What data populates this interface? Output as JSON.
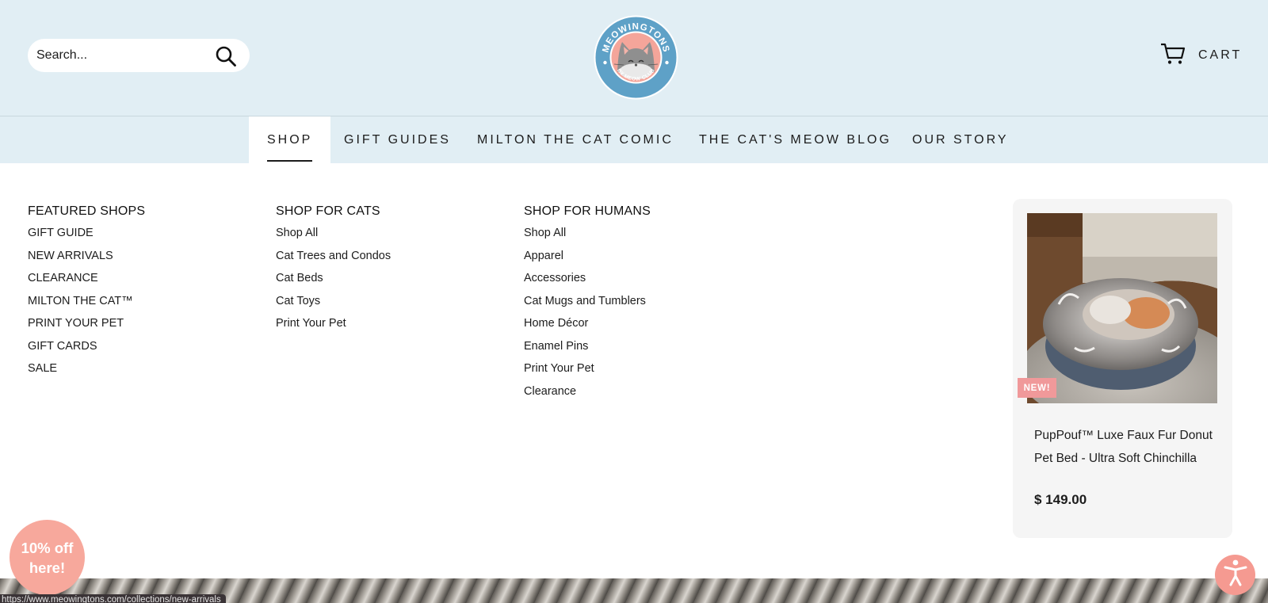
{
  "header": {
    "search": {
      "placeholder": "Search...",
      "icon": "search-icon"
    },
    "logo": {
      "text_top": "MEOWINGTONS",
      "text_bottom": "BY MEOW CLUB",
      "colors": {
        "ring": "#5ea1c7",
        "inner": "#f4a59a",
        "cat": "#8f8f8f"
      }
    },
    "cart": {
      "label": "CART",
      "icon": "cart-icon"
    }
  },
  "nav": {
    "items": [
      {
        "label": "SHOP",
        "active": true
      },
      {
        "label": "GIFT GUIDES",
        "active": false
      },
      {
        "label": "MILTON THE CAT COMIC",
        "active": false
      },
      {
        "label": "THE CAT'S MEOW BLOG",
        "active": false
      },
      {
        "label": "OUR STORY",
        "active": false
      }
    ]
  },
  "mega_menu": {
    "columns": [
      {
        "heading": "FEATURED SHOPS",
        "links": [
          "GIFT GUIDE",
          "NEW ARRIVALS",
          "CLEARANCE",
          "MILTON THE CAT™",
          "PRINT YOUR PET",
          "GIFT CARDS",
          "SALE"
        ]
      },
      {
        "heading": "SHOP FOR CATS",
        "links": [
          "Shop All",
          "Cat Trees and Condos",
          "Cat Beds",
          "Cat Toys",
          "Print Your Pet"
        ]
      },
      {
        "heading": "SHOP FOR HUMANS",
        "links": [
          "Shop All",
          "Apparel",
          "Accessories",
          "Cat Mugs and Tumblers",
          "Home Décor",
          "Enamel Pins",
          "Print Your Pet",
          "Clearance"
        ]
      }
    ],
    "featured_product": {
      "badge": "NEW!",
      "title": "PupPouf™ Luxe Faux Fur Donut Pet Bed - Ultra Soft Chinchilla",
      "price": "$ 149.00"
    }
  },
  "promo": {
    "label": "10% off here!"
  },
  "accessibility": {
    "icon": "accessibility-icon"
  },
  "status_bar": {
    "url": "https://www.meowingtons.com/collections/new-arrivals"
  },
  "colors": {
    "header_bg": "#e1eef4",
    "badge_bg": "#f0999a",
    "promo_bg": "#f7a89c",
    "a11y_bg": "#f59a91"
  }
}
